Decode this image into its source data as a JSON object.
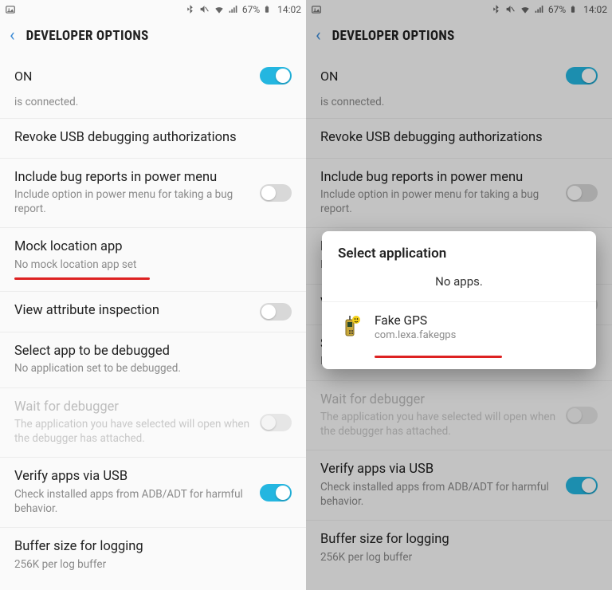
{
  "status": {
    "battery_pct": "67%",
    "time": "14:02"
  },
  "header": {
    "title": "DEVELOPER OPTIONS"
  },
  "master": {
    "label": "ON",
    "cut_subtitle": "is connected."
  },
  "rows": {
    "revoke": {
      "title": "Revoke USB debugging authorizations"
    },
    "bugreport": {
      "title": "Include bug reports in power menu",
      "sub": "Include option in power menu for taking a bug report."
    },
    "mockloc": {
      "title": "Mock location app",
      "sub": "No mock location app set"
    },
    "attr": {
      "title": "View attribute inspection"
    },
    "debugapp": {
      "title": "Select app to be debugged",
      "sub": "No application set to be debugged."
    },
    "waitdbg": {
      "title": "Wait for debugger",
      "sub": "The application you have selected will open when the debugger has attached."
    },
    "verifyusb": {
      "title": "Verify apps via USB",
      "sub": "Check installed apps from ADB/ADT for harmful behavior."
    },
    "buffer": {
      "title": "Buffer size for logging",
      "sub": "256K per log buffer"
    }
  },
  "dialog": {
    "title": "Select application",
    "no_apps": "No apps.",
    "app": {
      "name": "Fake GPS",
      "package": "com.lexa.fakegps"
    }
  }
}
